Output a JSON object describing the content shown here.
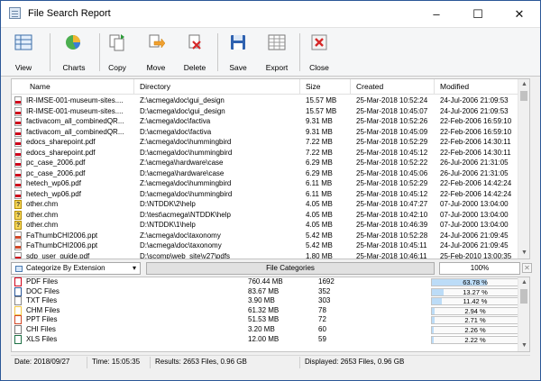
{
  "window": {
    "title": "File Search Report",
    "min": "–",
    "max": "☐",
    "close": "✕"
  },
  "toolbar": [
    {
      "label": "View",
      "icon": "grid-view-icon"
    },
    {
      "label": "Charts",
      "icon": "charts-icon"
    },
    {
      "label": "Copy",
      "icon": "copy-icon"
    },
    {
      "label": "Move",
      "icon": "move-icon"
    },
    {
      "label": "Delete",
      "icon": "delete-icon"
    },
    {
      "label": "Save",
      "icon": "save-icon"
    },
    {
      "label": "Export",
      "icon": "export-icon"
    },
    {
      "label": "Close",
      "icon": "close-report-icon"
    }
  ],
  "table": {
    "columns": [
      "Name",
      "Directory",
      "Size",
      "Created",
      "Modified"
    ],
    "rows": [
      {
        "icon": "pdf",
        "name": "IR-IMSE-001-museum-sites....",
        "dir": "Z:\\acmega\\doc\\gui_design",
        "size": "15.57 MB",
        "created": "25-Mar-2018 10:52:24",
        "modified": "24-Jul-2006 21:09:53"
      },
      {
        "icon": "pdf",
        "name": "IR-IMSE-001-museum-sites....",
        "dir": "D:\\acmega\\doc\\gui_design",
        "size": "15.57 MB",
        "created": "25-Mar-2018 10:45:07",
        "modified": "24-Jul-2006 21:09:53"
      },
      {
        "icon": "pdf",
        "name": "factivacom_all_combinedQR...",
        "dir": "Z:\\acmega\\doc\\factiva",
        "size": "9.31 MB",
        "created": "25-Mar-2018 10:52:26",
        "modified": "22-Feb-2006 16:59:10"
      },
      {
        "icon": "pdf",
        "name": "factivacom_all_combinedQR...",
        "dir": "D:\\acmega\\doc\\factiva",
        "size": "9.31 MB",
        "created": "25-Mar-2018 10:45:09",
        "modified": "22-Feb-2006 16:59:10"
      },
      {
        "icon": "pdf",
        "name": "edocs_sharepoint.pdf",
        "dir": "Z:\\acmega\\doc\\hummingbird",
        "size": "7.22 MB",
        "created": "25-Mar-2018 10:52:29",
        "modified": "22-Feb-2006 14:30:11"
      },
      {
        "icon": "pdf",
        "name": "edocs_sharepoint.pdf",
        "dir": "D:\\acmega\\doc\\hummingbird",
        "size": "7.22 MB",
        "created": "25-Mar-2018 10:45:12",
        "modified": "22-Feb-2006 14:30:11"
      },
      {
        "icon": "pdf",
        "name": "pc_case_2006.pdf",
        "dir": "Z:\\acmega\\hardware\\case",
        "size": "6.29 MB",
        "created": "25-Mar-2018 10:52:22",
        "modified": "26-Jul-2006 21:31:05"
      },
      {
        "icon": "pdf",
        "name": "pc_case_2006.pdf",
        "dir": "D:\\acmega\\hardware\\case",
        "size": "6.29 MB",
        "created": "25-Mar-2018 10:45:06",
        "modified": "26-Jul-2006 21:31:05"
      },
      {
        "icon": "pdf",
        "name": "hetech_wp06.pdf",
        "dir": "Z:\\acmega\\doc\\hummingbird",
        "size": "6.11 MB",
        "created": "25-Mar-2018 10:52:29",
        "modified": "22-Feb-2006 14:42:24"
      },
      {
        "icon": "pdf",
        "name": "hetech_wp06.pdf",
        "dir": "D:\\acmega\\doc\\hummingbird",
        "size": "6.11 MB",
        "created": "25-Mar-2018 10:45:12",
        "modified": "22-Feb-2006 14:42:24"
      },
      {
        "icon": "chm",
        "name": "other.chm",
        "dir": "D:\\NTDDK\\2\\help",
        "size": "4.05 MB",
        "created": "25-Mar-2018 10:47:27",
        "modified": "07-Jul-2000 13:04:00"
      },
      {
        "icon": "chm",
        "name": "other.chm",
        "dir": "D:\\test\\acmega\\NTDDK\\help",
        "size": "4.05 MB",
        "created": "25-Mar-2018 10:42:10",
        "modified": "07-Jul-2000 13:04:00"
      },
      {
        "icon": "chm",
        "name": "other.chm",
        "dir": "D:\\NTDDK\\1\\help",
        "size": "4.05 MB",
        "created": "25-Mar-2018 10:46:39",
        "modified": "07-Jul-2000 13:04:00"
      },
      {
        "icon": "ppt",
        "name": "FaThumbCHI2006.ppt",
        "dir": "Z:\\acmega\\doc\\taxonomy",
        "size": "5.42 MB",
        "created": "25-Mar-2018 10:52:28",
        "modified": "24-Jul-2006 21:09:45"
      },
      {
        "icon": "ppt",
        "name": "FaThumbCHI2006.ppt",
        "dir": "D:\\acmega\\doc\\taxonomy",
        "size": "5.42 MB",
        "created": "25-Mar-2018 10:45:11",
        "modified": "24-Jul-2006 21:09:45"
      },
      {
        "icon": "pdf",
        "name": "sdp_user_guide.pdf",
        "dir": "D:\\scomp\\web_site\\v27\\pdfs",
        "size": "1.80 MB",
        "created": "25-Mar-2018 10:46:11",
        "modified": "25-Feb-2010 13:00:35"
      }
    ]
  },
  "categorize": {
    "selected": "Categorize By Extension",
    "button": "File Categories",
    "percent": "100%",
    "close": "✕"
  },
  "categories": [
    {
      "icon": "pdf",
      "name": "PDF Files",
      "size": "760.44 MB",
      "count": "1692",
      "pct_text": "63.78 %",
      "pct": 63.78
    },
    {
      "icon": "doc",
      "name": "DOC Files",
      "size": "83.67 MB",
      "count": "352",
      "pct_text": "13.27 %",
      "pct": 13.27
    },
    {
      "icon": "txt",
      "name": "TXT Files",
      "size": "3.90 MB",
      "count": "303",
      "pct_text": "11.42 %",
      "pct": 11.42
    },
    {
      "icon": "chm",
      "name": "CHM Files",
      "size": "61.32 MB",
      "count": "78",
      "pct_text": "2.94 %",
      "pct": 2.94
    },
    {
      "icon": "ppt",
      "name": "PPT Files",
      "size": "51.53 MB",
      "count": "72",
      "pct_text": "2.71 %",
      "pct": 2.71
    },
    {
      "icon": "chi",
      "name": "CHI Files",
      "size": "3.20 MB",
      "count": "60",
      "pct_text": "2.26 %",
      "pct": 2.26
    },
    {
      "icon": "xls",
      "name": "XLS Files",
      "size": "12.00 MB",
      "count": "59",
      "pct_text": "2.22 %",
      "pct": 2.22
    }
  ],
  "status": {
    "date": "Date: 2018/09/27",
    "time": "Time: 15:05:35",
    "results": "Results: 2653 Files, 0.96 GB",
    "displayed": "Displayed: 2653 Files, 0.96 GB"
  }
}
